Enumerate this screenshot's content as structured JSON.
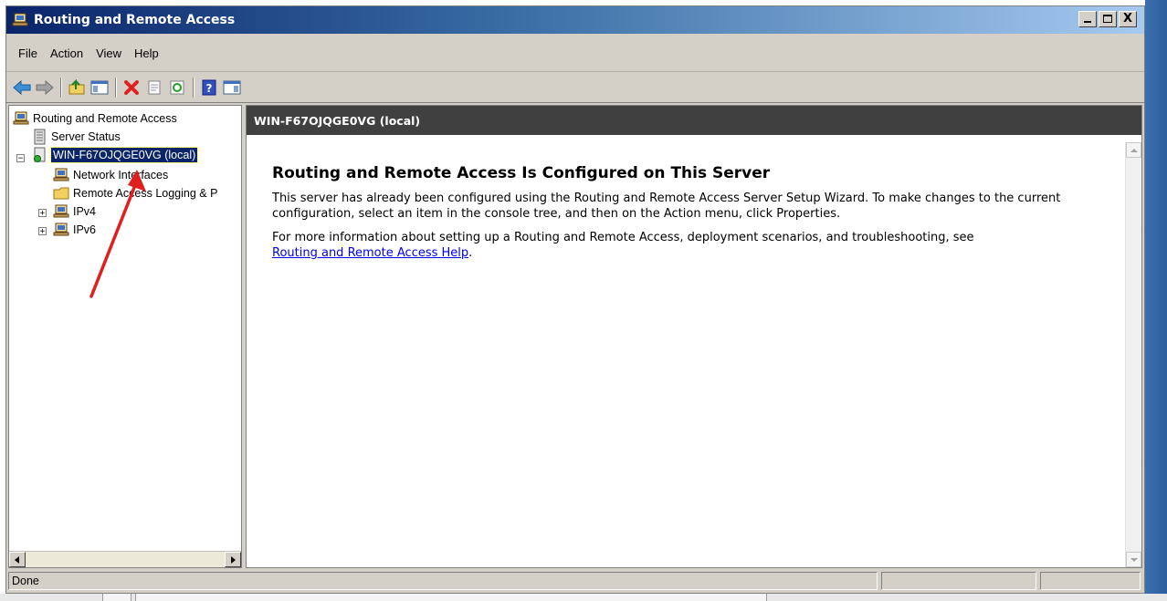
{
  "window": {
    "title": "Routing and Remote Access",
    "controls": {
      "minimize": "_",
      "maximize": "□",
      "close": "X"
    }
  },
  "menu": [
    "File",
    "Action",
    "View",
    "Help"
  ],
  "toolbar": {
    "buttons": [
      "back-arrow-icon",
      "forward-arrow-icon",
      "up-folder-icon",
      "show-hide-tree-icon",
      "delete-icon",
      "properties-icon",
      "refresh-icon",
      "help-icon",
      "show-hide-action-pane-icon"
    ]
  },
  "tree": {
    "root": "Routing and Remote Access",
    "items": [
      {
        "label": "Server Status"
      },
      {
        "label": "WIN-F67OJQGE0VG (local)",
        "expander": "⊟",
        "selected": true
      },
      {
        "label": "Network Interfaces"
      },
      {
        "label": "Remote Access Logging & P"
      },
      {
        "label": "IPv4",
        "expander": "⊞"
      },
      {
        "label": "IPv6",
        "expander": "⊞"
      }
    ]
  },
  "content": {
    "header": "WIN-F67OJQGE0VG (local)",
    "heading": "Routing and Remote Access Is Configured on This Server",
    "paragraph1": "This server has already been configured using the Routing and Remote Access Server Setup Wizard. To make changes to the current configuration, select an item in the console tree, and then on the Action menu, click Properties.",
    "paragraph2_prefix": "For more information about setting up a Routing and Remote Access, deployment scenarios, and troubleshooting, see",
    "help_link": "Routing and Remote Access Help",
    "paragraph2_suffix": "."
  },
  "status": {
    "text": "Done"
  },
  "colors": {
    "title_start": "#0a246a",
    "title_end": "#a6caf0",
    "header_bg": "#404040",
    "selection": "#0a246a",
    "annotation_arrow": "#e02020",
    "link": "#0000ee"
  }
}
